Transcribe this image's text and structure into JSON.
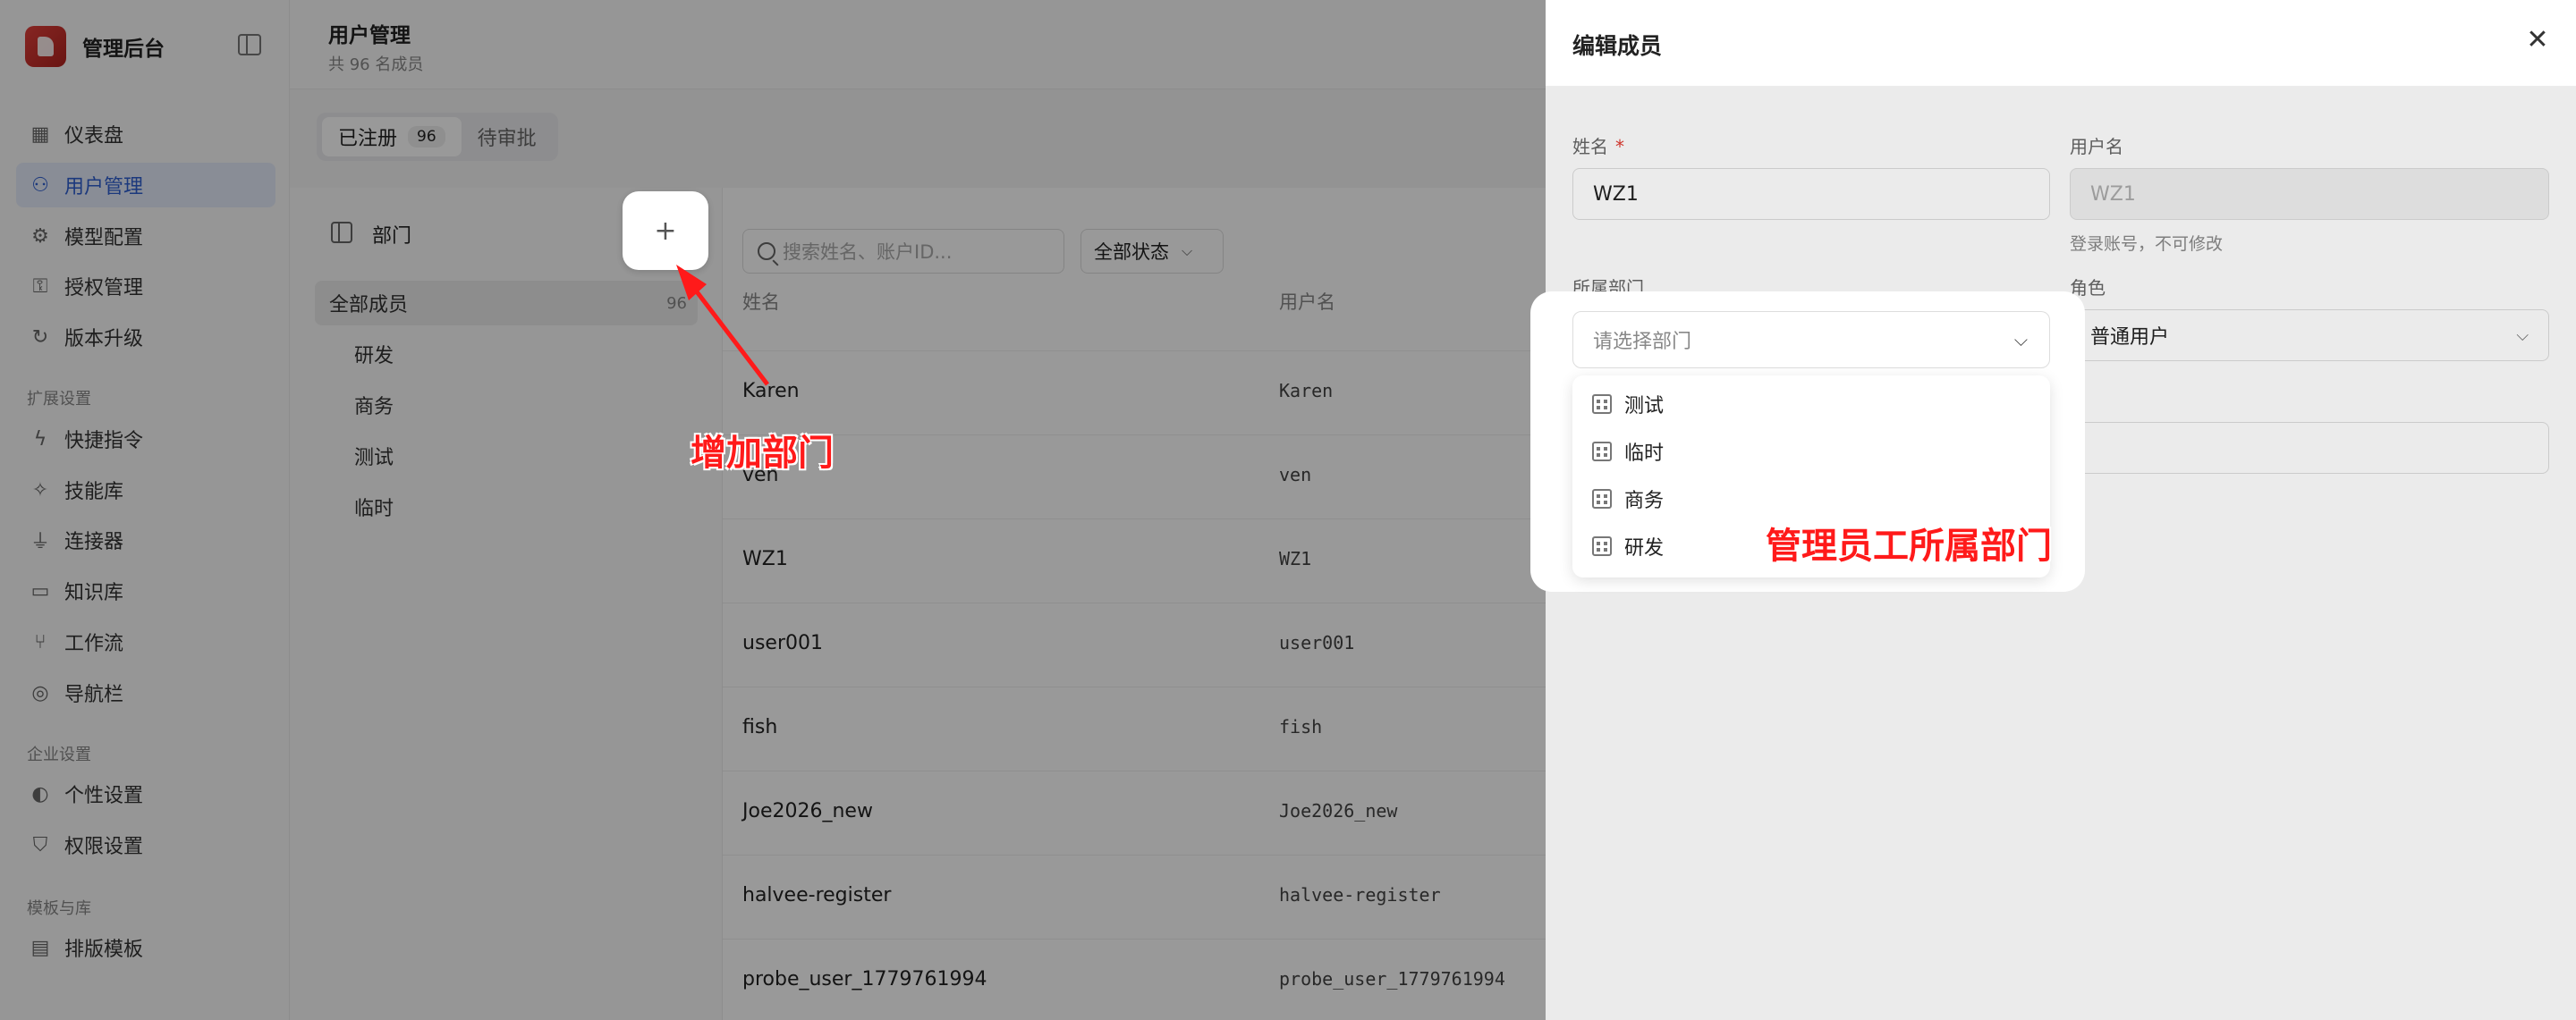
{
  "sidebar": {
    "brand": "管理后台",
    "items": [
      {
        "label": "仪表盘",
        "icon": "dashboard-icon"
      },
      {
        "label": "用户管理",
        "icon": "users-icon",
        "active": true
      },
      {
        "label": "模型配置",
        "icon": "chip-icon"
      },
      {
        "label": "授权管理",
        "icon": "key-icon"
      },
      {
        "label": "版本升级",
        "icon": "refresh-icon"
      }
    ],
    "sections": [
      {
        "title": "扩展设置",
        "items": [
          {
            "label": "快捷指令",
            "icon": "lightning-icon"
          },
          {
            "label": "技能库",
            "icon": "wand-icon"
          },
          {
            "label": "连接器",
            "icon": "plug-icon"
          },
          {
            "label": "知识库",
            "icon": "book-icon"
          },
          {
            "label": "工作流",
            "icon": "workflow-icon"
          },
          {
            "label": "导航栏",
            "icon": "compass-icon"
          }
        ]
      },
      {
        "title": "企业设置",
        "items": [
          {
            "label": "个性设置",
            "icon": "palette-icon"
          },
          {
            "label": "权限设置",
            "icon": "shield-icon"
          }
        ]
      },
      {
        "title": "模板与库",
        "items": [
          {
            "label": "排版模板",
            "icon": "layout-icon"
          }
        ]
      }
    ]
  },
  "header": {
    "title": "用户管理",
    "subtitle": "共 96 名成员"
  },
  "tabs": [
    {
      "label": "已注册",
      "count": "96"
    },
    {
      "label": "待审批"
    }
  ],
  "departments": {
    "title": "部门",
    "add_label": "+",
    "all": {
      "label": "全部成员",
      "count": "96"
    },
    "items": [
      "研发",
      "商务",
      "测试",
      "临时"
    ]
  },
  "table": {
    "search_placeholder": "搜索姓名、账户ID...",
    "status_filter": "全部状态",
    "columns": [
      "姓名",
      "用户名"
    ],
    "rows": [
      {
        "name": "Karen",
        "username": "Karen"
      },
      {
        "name": "ven",
        "username": "ven"
      },
      {
        "name": "WZ1",
        "username": "WZ1"
      },
      {
        "name": "user001",
        "username": "user001"
      },
      {
        "name": "fish",
        "username": "fish"
      },
      {
        "name": "Joe2026_new",
        "username": "Joe2026_new"
      },
      {
        "name": "halvee-register",
        "username": "halvee-register"
      },
      {
        "name": "probe_user_1779761994",
        "username": "probe_user_1779761994"
      }
    ]
  },
  "drawer": {
    "title": "编辑成员",
    "name_label": "姓名",
    "required_mark": "*",
    "name_value": "WZ1",
    "username_label": "用户名",
    "username_value": "WZ1",
    "username_help": "登录账号，不可修改",
    "dept_label": "所属部门",
    "dept_placeholder": "请选择部门",
    "role_label": "角色",
    "role_value": "普通用户",
    "dept_options": [
      "测试",
      "临时",
      "商务",
      "研发"
    ]
  },
  "annotations": {
    "add_dept": "增加部门",
    "manage_dept": "管理员工所属部门"
  }
}
